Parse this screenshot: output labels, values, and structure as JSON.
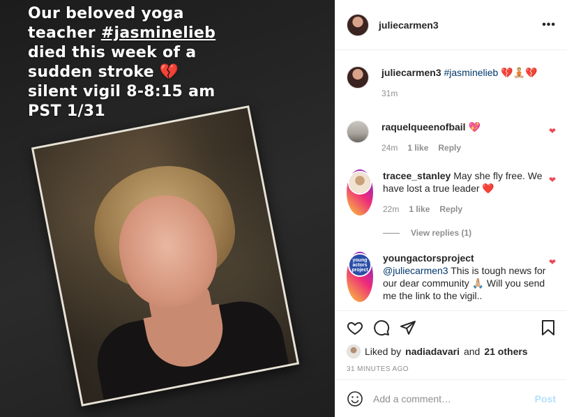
{
  "media": {
    "caption_line1": "Our beloved yoga",
    "caption_line2_pre": "teacher ",
    "caption_line2_tag": "#jasminelieb",
    "caption_line3": "died this week of a",
    "caption_line4": "sudden stroke 💔",
    "caption_line5": "silent vigil 8-8:15 am",
    "caption_line6": "PST 1/31"
  },
  "header": {
    "username": "juliecarmen3",
    "more_icon": "more-dots-icon"
  },
  "caption": {
    "username": "juliecarmen3",
    "text_tag": "#jasminelieb",
    "text_emoji": "💔🧘🏼💔",
    "time": "31m"
  },
  "comments": [
    {
      "username": "raquelqueenofbail",
      "text": "💖",
      "time": "24m",
      "likes": "1 like",
      "reply": "Reply"
    },
    {
      "username": "tracee_stanley",
      "text": "May she fly free. We have lost a true leader ❤️",
      "time": "22m",
      "likes": "1 like",
      "reply": "Reply"
    },
    {
      "username": "youngactorsproject",
      "mention": "@juliecarmen3",
      "text": "This is tough news for our dear community 🙏🏼 Will you send me the link to the vigil..",
      "avatar_text": "young actors project"
    }
  ],
  "view_replies": "View replies (1)",
  "likes": {
    "prefix": "Liked by",
    "user": "nadiadavari",
    "and": "and",
    "others": "21 others"
  },
  "timestamp": "31 MINUTES AGO",
  "add_comment": {
    "placeholder": "Add a comment…",
    "post_label": "Post"
  },
  "colors": {
    "heart_red": "#ed4956",
    "link_blue": "#00376b",
    "post_disabled": "#b2dffc"
  }
}
